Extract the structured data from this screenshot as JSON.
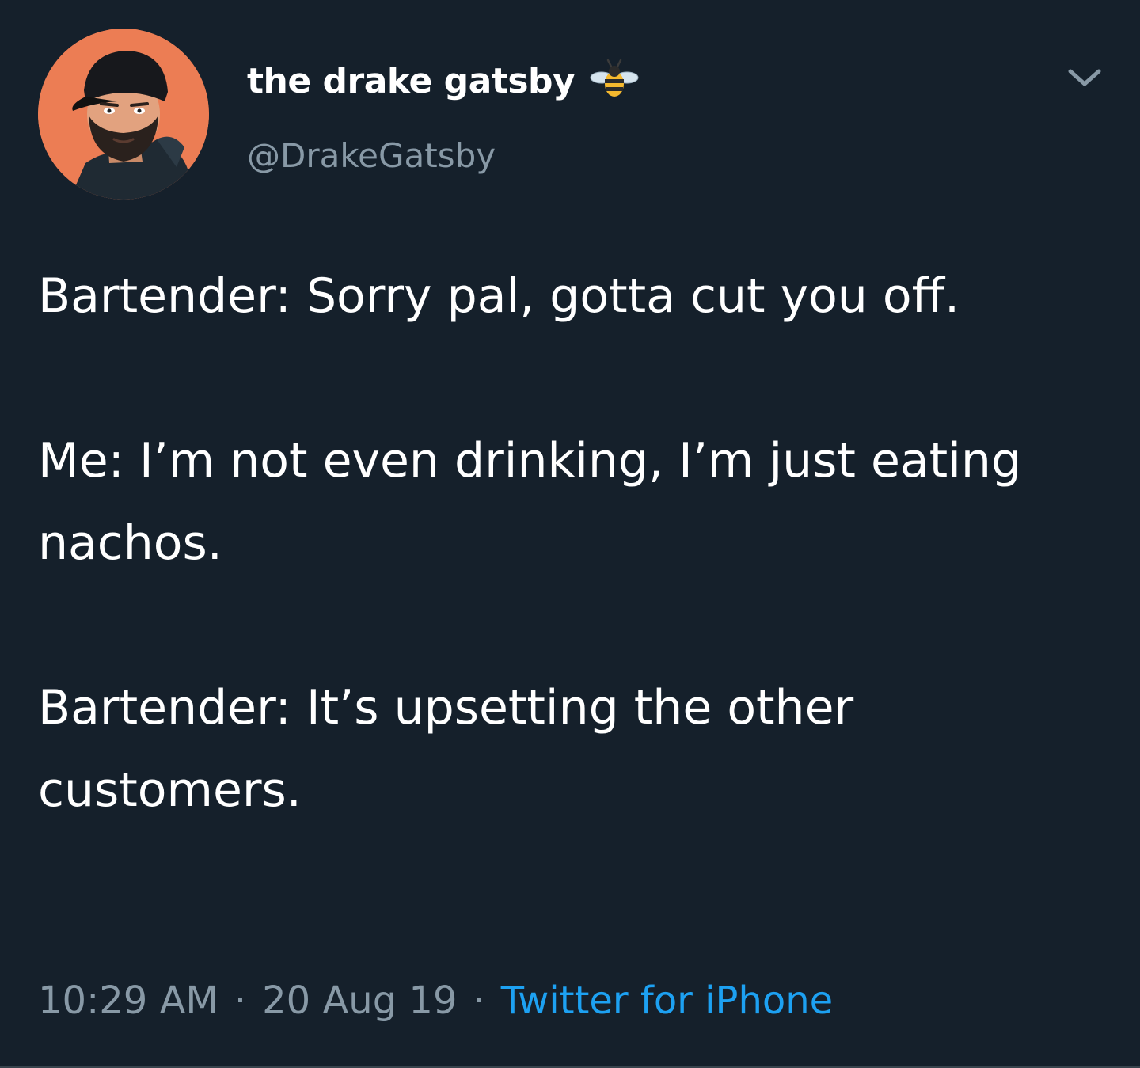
{
  "tweet": {
    "author": {
      "display_name": "the drake gatsby",
      "handle": "@DrakeGatsby",
      "name_emoji": "bee-icon",
      "avatar": "avatar-illustration"
    },
    "menu_icon": "chevron-down-icon",
    "body": [
      "Bartender: Sorry pal, gotta cut you off.",
      "Me: I’m not even drinking, I’m just eating nachos.",
      "Bartender: It’s upsetting the other customers."
    ],
    "meta": {
      "time": "10:29 AM",
      "date": "20 Aug 19",
      "separator": "·",
      "source": "Twitter for iPhone"
    }
  },
  "colors": {
    "background": "#15202b",
    "text": "#ffffff",
    "secondary": "#8899a6",
    "link": "#1da1f2",
    "avatar_bg": "#ec7d54"
  }
}
